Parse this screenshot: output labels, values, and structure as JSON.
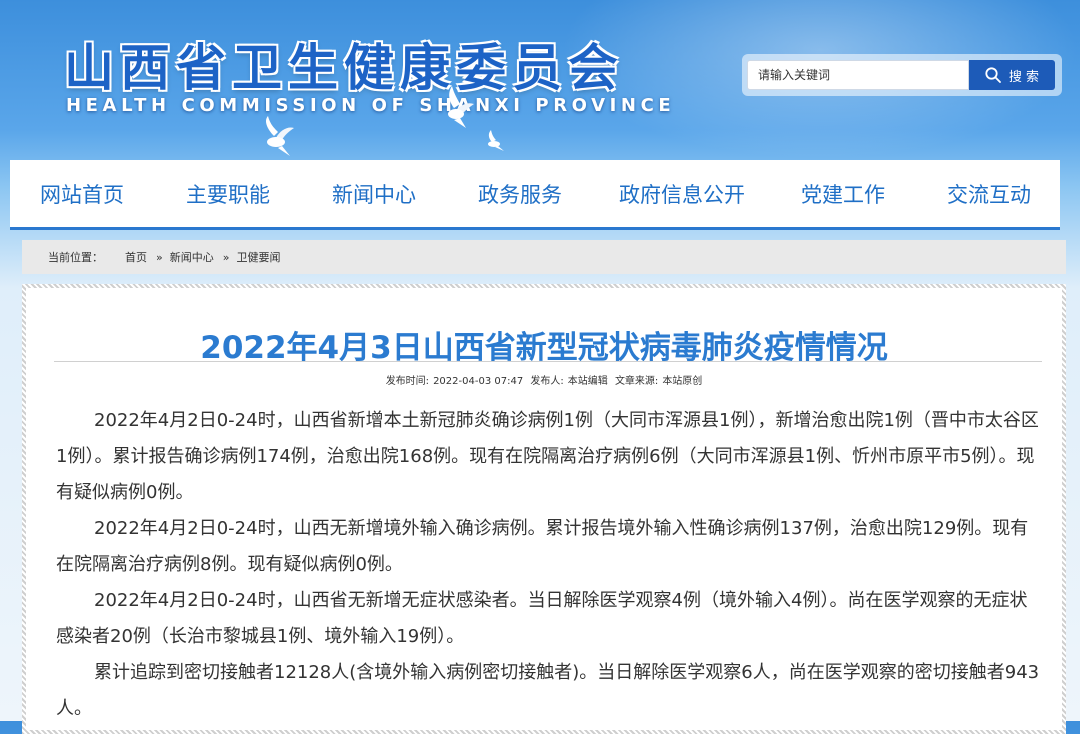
{
  "header": {
    "logo_cn": "山西省卫生健康委员会",
    "logo_en": "HEALTH COMMISSION OF SHANXI PROVINCE"
  },
  "search": {
    "placeholder": "请输入关键词",
    "button_label": "搜 索"
  },
  "nav": {
    "items": [
      {
        "label": "网站首页"
      },
      {
        "label": "主要职能"
      },
      {
        "label": "新闻中心"
      },
      {
        "label": "政务服务"
      },
      {
        "label": "政府信息公开"
      },
      {
        "label": "党建工作"
      },
      {
        "label": "交流互动"
      }
    ]
  },
  "breadcrumb": {
    "label": "当前位置：",
    "items": [
      "首页",
      "新闻中心",
      "卫健要闻"
    ],
    "separator": "»"
  },
  "article": {
    "title": "2022年4月3日山西省新型冠状病毒肺炎疫情情况",
    "meta": {
      "time_label": "发布时间:",
      "time": "2022-04-03 07:47",
      "author_label": "发布人:",
      "author": "本站编辑",
      "source_label": "文章来源:",
      "source": "本站原创"
    },
    "paragraphs": [
      "2022年4月2日0-24时，山西省新增本土新冠肺炎确诊病例1例（大同市浑源县1例），新增治愈出院1例（晋中市太谷区1例）。累计报告确诊病例174例，治愈出院168例。现有在院隔离治疗病例6例（大同市浑源县1例、忻州市原平市5例）。现有疑似病例0例。",
      "2022年4月2日0-24时，山西无新增境外输入确诊病例。累计报告境外输入性确诊病例137例，治愈出院129例。现有在院隔离治疗病例8例。现有疑似病例0例。",
      "2022年4月2日0-24时，山西省无新增无症状感染者。当日解除医学观察4例（境外输入4例）。尚在医学观察的无症状感染者20例（长治市黎城县1例、境外输入19例）。",
      "累计追踪到密切接触者12128人(含境外输入病例密切接触者)。当日解除医学观察6人，尚在医学观察的密切接触者943人。"
    ]
  }
}
